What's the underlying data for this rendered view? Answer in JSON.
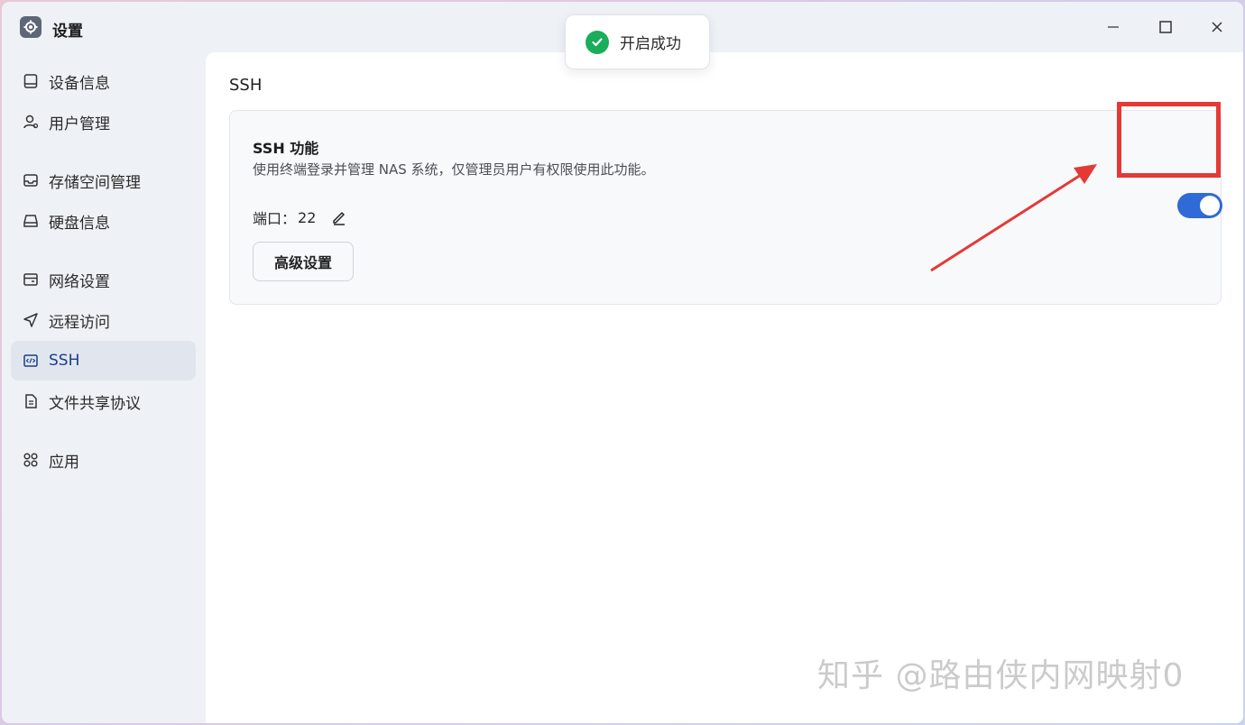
{
  "window": {
    "title": "设置",
    "icon": "gear-icon"
  },
  "toast": {
    "text": "开启成功",
    "icon": "check-circle-icon",
    "color": "#1aad5a"
  },
  "sidebar": {
    "items": [
      {
        "label": "设备信息",
        "icon": "device-icon"
      },
      {
        "label": "用户管理",
        "icon": "user-icon"
      },
      {
        "label": "存储空间管理",
        "icon": "storage-icon"
      },
      {
        "label": "硬盘信息",
        "icon": "disk-icon"
      },
      {
        "label": "网络设置",
        "icon": "network-icon"
      },
      {
        "label": "远程访问",
        "icon": "send-icon"
      },
      {
        "label": "SSH",
        "icon": "code-icon",
        "active": true
      },
      {
        "label": "文件共享协议",
        "icon": "file-icon"
      },
      {
        "label": "应用",
        "icon": "apps-icon"
      }
    ]
  },
  "main": {
    "section_title": "SSH",
    "card": {
      "title": "SSH 功能",
      "description": "使用终端登录并管理 NAS 系统，仅管理员用户有权限使用此功能。",
      "port_label": "端口：",
      "port_value": "22",
      "advanced_button": "高级设置",
      "toggle_on": true
    }
  },
  "annotation": {
    "box_color": "#e53935"
  },
  "watermark": "知乎 @路由侠内网映射0",
  "colors": {
    "accent": "#2f6ad6",
    "active_nav_text": "#1a3d8c"
  }
}
